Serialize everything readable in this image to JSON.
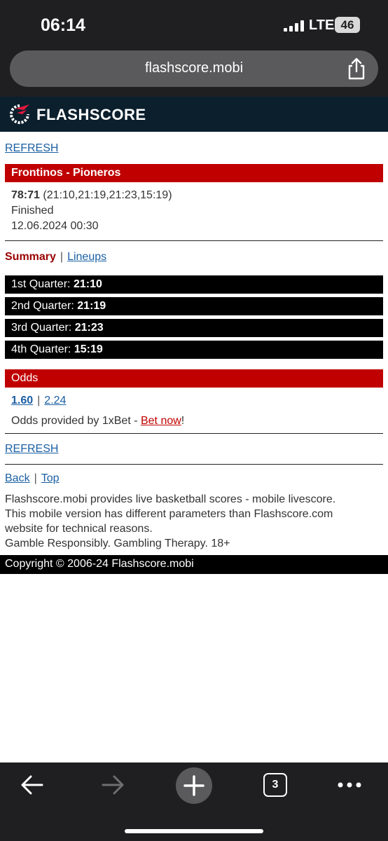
{
  "status_bar": {
    "time": "06:14",
    "network": "LTE",
    "battery": "46"
  },
  "browser": {
    "url": "flashscore.mobi",
    "tab_count": "3"
  },
  "site": {
    "logo_text": "FLASHSCORE"
  },
  "page": {
    "refresh_label": "REFRESH",
    "match_title": "Frontinos - Pioneros",
    "score": "78:71",
    "quarters_summary": "(21:10,21:19,21:23,15:19)",
    "status": "Finished",
    "datetime": "12.06.2024 00:30",
    "tabs": {
      "summary": "Summary",
      "separator": "|",
      "lineups": "Lineups"
    },
    "quarters": [
      {
        "label": "1st Quarter:",
        "score": "21:10"
      },
      {
        "label": "2nd Quarter:",
        "score": "21:19"
      },
      {
        "label": "3rd Quarter:",
        "score": "21:23"
      },
      {
        "label": "4th Quarter:",
        "score": "15:19"
      }
    ],
    "odds": {
      "title": "Odds",
      "home": "1.60",
      "separator": "|",
      "away": "2.24",
      "provider_text": "Odds provided by 1xBet - ",
      "bet_now": "Bet now",
      "exclaim": "!"
    },
    "refresh_label_2": "REFRESH",
    "nav": {
      "back": "Back",
      "separator": "|",
      "top": "Top"
    },
    "footer_line1": "Flashscore.mobi provides live basketball scores - mobile livescore.",
    "footer_line2": "This mobile version has different parameters than Flashscore.com",
    "footer_line3": "website for technical reasons.",
    "footer_line4": "Gamble Responsibly. Gambling Therapy. 18+",
    "copyright": "Copyright © 2006-24 Flashscore.mobi"
  },
  "colors": {
    "accent_red": "#c00000",
    "header_navy": "#0b1f2d",
    "link_blue": "#1b5fa3"
  }
}
